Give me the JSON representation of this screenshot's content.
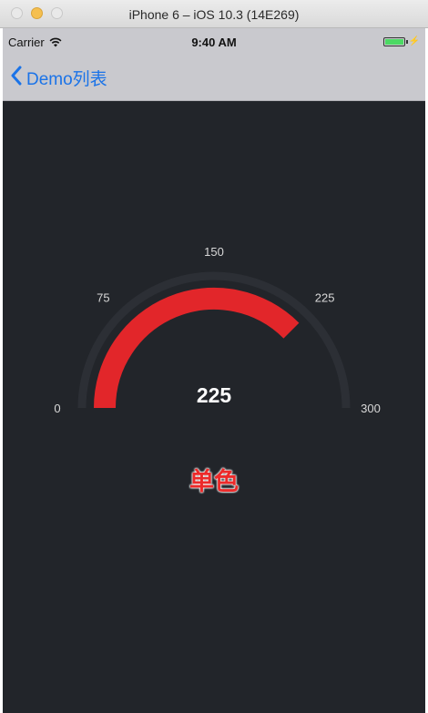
{
  "window": {
    "title": "iPhone 6 – iOS 10.3 (14E269)"
  },
  "status_bar": {
    "carrier": "Carrier",
    "time": "9:40 AM",
    "battery_level": 1.0
  },
  "nav": {
    "back_label": "Demo列表",
    "icon": "chevron-left-icon"
  },
  "gauge": {
    "min": 0,
    "max": 300,
    "value": 225,
    "value_label": "225",
    "ticks": [
      "0",
      "75",
      "150",
      "225",
      "300"
    ],
    "tick_values": [
      0,
      75,
      150,
      225,
      300
    ],
    "progress_color": "#e2262a",
    "track_color": "#2c2f35"
  },
  "caption": "单色",
  "colors": {
    "background": "#22252a",
    "accent": "#1a73e8",
    "caption": "#ec2a2a"
  }
}
